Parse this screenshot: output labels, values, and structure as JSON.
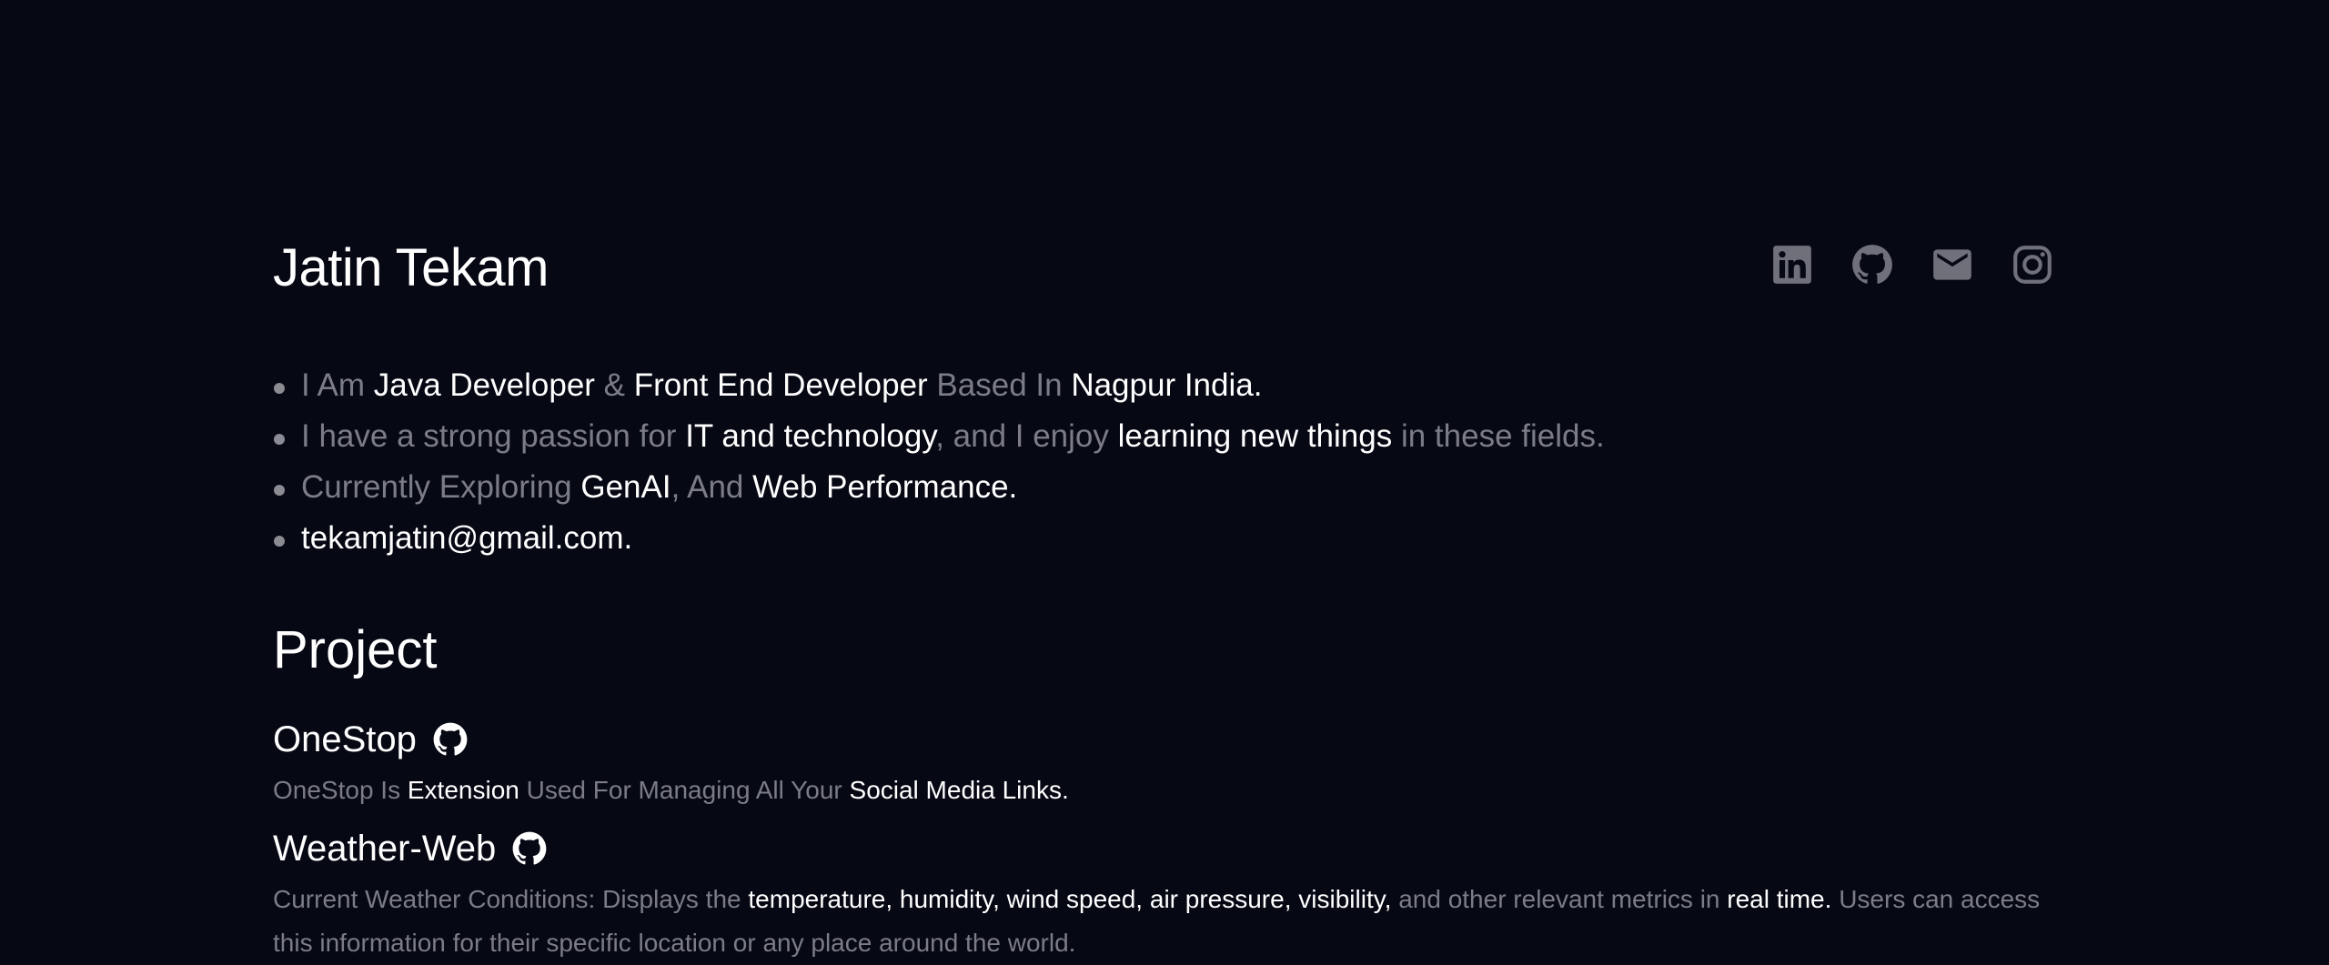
{
  "profile": {
    "name": "Jatin Tekam"
  },
  "socials": [
    {
      "icon": "linkedin-icon",
      "label": "LinkedIn"
    },
    {
      "icon": "github-icon",
      "label": "GitHub"
    },
    {
      "icon": "mail-icon",
      "label": "Email"
    },
    {
      "icon": "instagram-icon",
      "label": "Instagram"
    }
  ],
  "about": {
    "line1": {
      "a": "I Am ",
      "b": "Java Developer",
      "c": " & ",
      "d": "Front End Developer",
      "e": " Based In ",
      "f": "Nagpur India."
    },
    "line2": {
      "a": "I have a strong passion for ",
      "b": "IT and technology",
      "c": ", and I enjoy ",
      "d": "learning new things",
      "e": " in these fields."
    },
    "line3": {
      "a": "Currently Exploring ",
      "b": "GenAI",
      "c": ", And ",
      "d": "Web Performance."
    },
    "line4": {
      "email": "tekamjatin@gmail.com."
    }
  },
  "projects_section": {
    "title": "Project"
  },
  "projects": [
    {
      "name": "OneStop",
      "desc": {
        "a": "OneStop Is ",
        "b": "Extension",
        "c": " Used For Managing All Your ",
        "d": "Social Media Links."
      }
    },
    {
      "name": "Weather-Web",
      "desc": {
        "a": "Current Weather Conditions: Displays the ",
        "b": "temperature, humidity, wind speed, air pressure, visibility,",
        "c": " and other relevant metrics in ",
        "d": "real time.",
        "e": " Users can access this information for their specific location or any place around the world."
      }
    }
  ],
  "colors": {
    "background": "#060814",
    "text_primary": "#ffffff",
    "text_muted": "#7b7c86",
    "icon": "#6f707a"
  }
}
